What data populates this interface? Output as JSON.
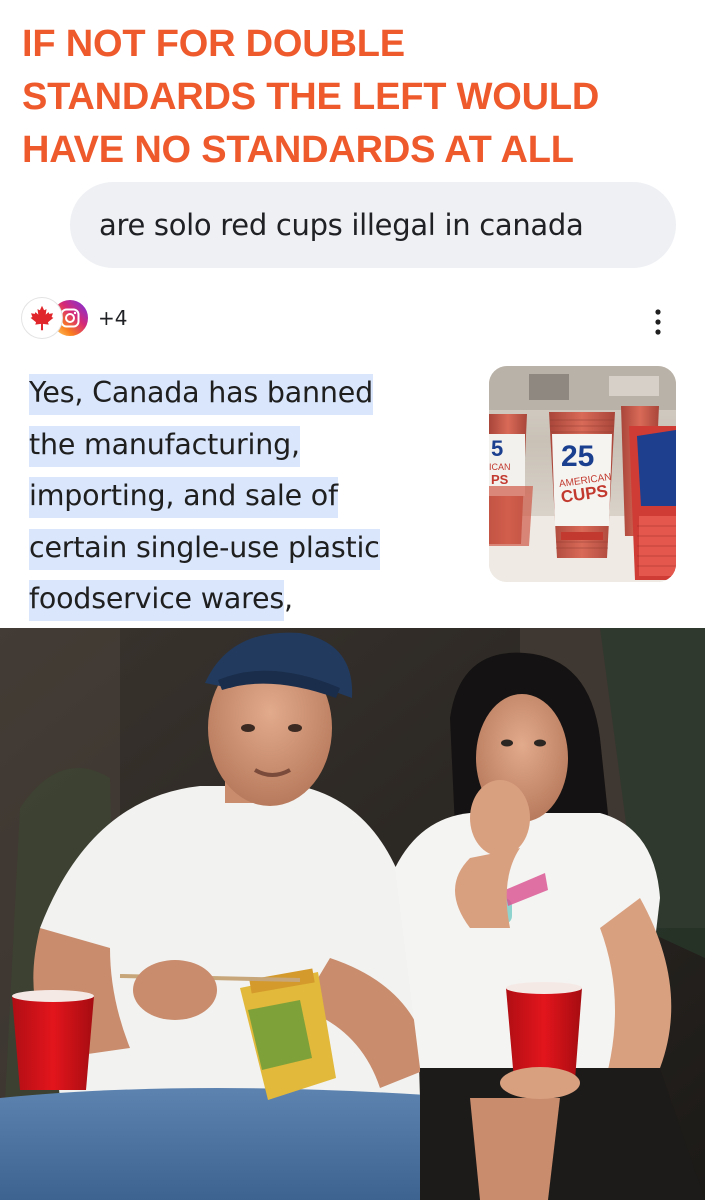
{
  "meme": {
    "headline_lines": [
      "IF NOT FOR DOUBLE",
      "STANDARDS THE LEFT WOULD",
      "HAVE NO STANDARDS AT ALL"
    ],
    "headline_color": "#ef5a2d"
  },
  "search": {
    "query": "are solo red cups illegal in canada"
  },
  "ai_overview": {
    "sources": {
      "icons": [
        "canadian-maple-leaf-icon",
        "instagram-icon"
      ],
      "more_count": "+4"
    },
    "menu_icon": "more-vert-icon",
    "answer_lines": [
      "Yes, Canada has banned",
      "the manufacturing,",
      "importing, and sale of",
      "certain single-use plastic",
      "foodservice wares"
    ],
    "answer_trailing": ",",
    "highlight_color": "#d9e6fb",
    "thumbnail": {
      "label_number": "25",
      "label_brand_line1": "AMERICAN",
      "label_brand_line2": "CUPS",
      "left_stack_text": "5",
      "left_stack_brand_line1": "ICAN",
      "left_stack_brand_line2": "PS"
    }
  },
  "photo": {
    "accent_color": "#e3151c"
  }
}
